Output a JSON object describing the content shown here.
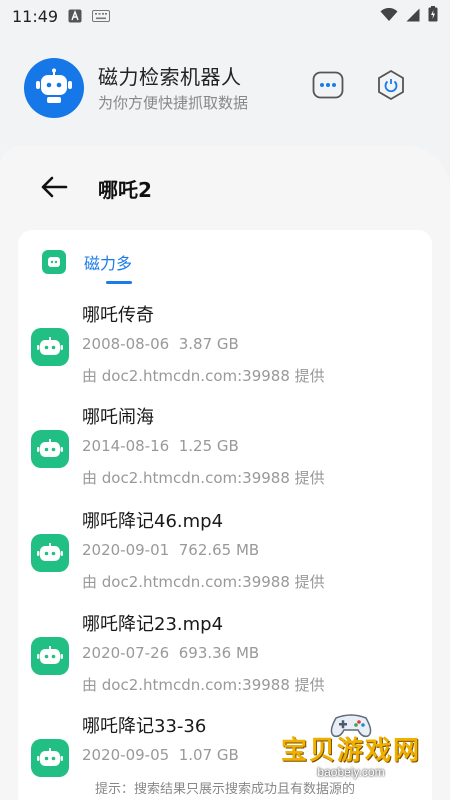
{
  "status_bar": {
    "time": "11:49"
  },
  "header": {
    "app_title": "磁力检索机器人",
    "app_subtitle": "为你方便快捷抓取数据",
    "avatar_icon": "robot-icon",
    "brand_color": "#1677e8"
  },
  "page": {
    "title": "哪吒2"
  },
  "source_tab": {
    "label": "磁力多",
    "accent_color": "#1a7be9"
  },
  "results": [
    {
      "title": "哪吒传奇",
      "date": "2008-08-06",
      "size": "3.87 GB",
      "source": "由 doc2.htmcdn.com:39988 提供"
    },
    {
      "title": "哪吒闹海",
      "date": "2014-08-16",
      "size": "1.25 GB",
      "source": "由 doc2.htmcdn.com:39988 提供"
    },
    {
      "title": "哪吒降记46.mp4",
      "date": "2020-09-01",
      "size": "762.65 MB",
      "source": "由 doc2.htmcdn.com:39988 提供"
    },
    {
      "title": "哪吒降记23.mp4",
      "date": "2020-07-26",
      "size": "693.36 MB",
      "source": "由 doc2.htmcdn.com:39988 提供"
    },
    {
      "title": "哪吒降记33-36",
      "date": "2020-09-05",
      "size": "1.07 GB",
      "source": ""
    }
  ],
  "hint": "提示：搜索结果只展示搜索成功且有数据源的",
  "watermark": {
    "text": "宝贝游戏网",
    "url": "baobeiy.com"
  },
  "result_icon_color": "#22bf84"
}
